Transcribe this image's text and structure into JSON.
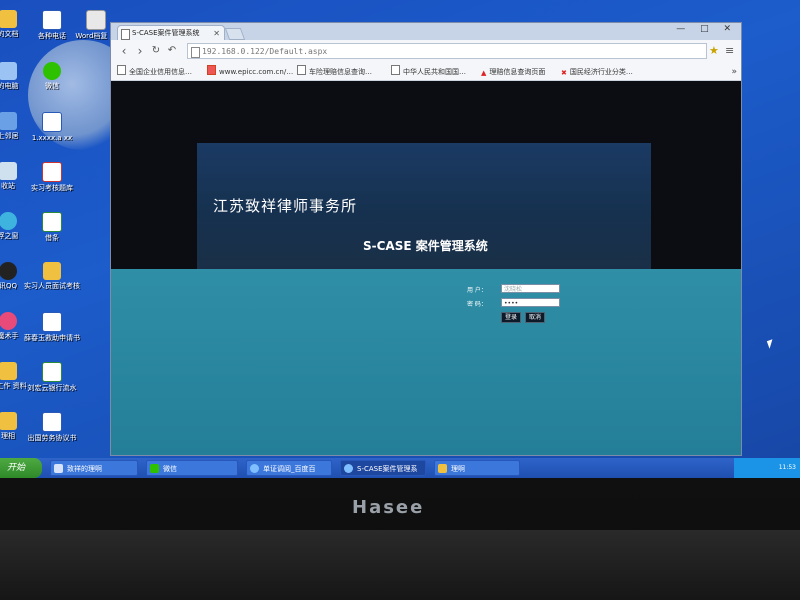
{
  "desktop": {
    "icons": [
      {
        "label": "的文档"
      },
      {
        "label": "各种电话"
      },
      {
        "label": "Word档复 属"
      },
      {
        "label": "的电脑"
      },
      {
        "label": "微信"
      },
      {
        "label": "上邻居"
      },
      {
        "label": "1.xxxx.a xx"
      },
      {
        "label": "收站"
      },
      {
        "label": "实习考核题库"
      },
      {
        "label": "浮之窗"
      },
      {
        "label": "借条"
      },
      {
        "label": "讯QQ"
      },
      {
        "label": "实习人员面试考核"
      },
      {
        "label": "魔术手"
      },
      {
        "label": "薛春玉救助申请书"
      },
      {
        "label": "图工作 资料"
      },
      {
        "label": "刘宏云银行流水"
      },
      {
        "label": "理相"
      },
      {
        "label": "出国劳务协议书"
      }
    ]
  },
  "browser": {
    "tab_title": "S-CASE案件管理系统",
    "address": "192.168.0.122/Default.aspx",
    "window_controls": "—  □  ✕",
    "bookmarks": [
      "全国企业信用信息…",
      "www.epicc.com.cn/…",
      "车险理赔信息查询…",
      "中华人民共和国国…",
      "理赔信息查询页面",
      "国民经济行业分类…"
    ],
    "bookmarks_more": "»"
  },
  "page": {
    "company": "江苏致祥律师事务所",
    "system_title": "S-CASE 案件管理系统",
    "login": {
      "user_label": "用 户：",
      "user_value": "沈晓松",
      "pass_label": "密 码：",
      "pass_value": "••••",
      "login_button": "登录",
      "cancel_button": "取消"
    }
  },
  "taskbar": {
    "start": "开始",
    "items": [
      "致祥的理啊",
      "微信",
      "单证调阅_百度百",
      "S-CASE案件管理系",
      "理啊"
    ],
    "clock": "11:53"
  },
  "laptop": {
    "brand": "Hasee"
  },
  "colors": {
    "desktop_bg": "#1c5ccb",
    "page_bg": "#0b0d12",
    "banner": "#1b3a64",
    "login_area": "#2a88a0",
    "taskbar": "#2757b8",
    "start_button": "#3a9a34"
  }
}
